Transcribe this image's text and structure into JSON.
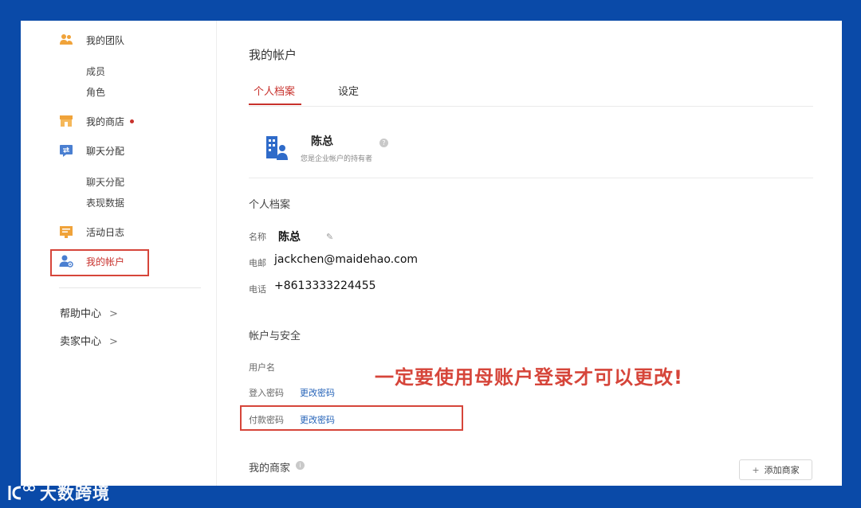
{
  "sidebar": {
    "team": {
      "label": "我的团队",
      "icon": "team-icon",
      "subitems": [
        "成员",
        "角色"
      ]
    },
    "store": {
      "label": "我的商店",
      "icon": "store-icon",
      "has_dot": true
    },
    "chat": {
      "label": "聊天分配",
      "icon": "chat-assign-icon",
      "subitems": [
        "聊天分配",
        "表现数据"
      ]
    },
    "log": {
      "label": "活动日志",
      "icon": "activity-log-icon"
    },
    "account": {
      "label": "我的帐户",
      "icon": "account-settings-icon",
      "active": true
    },
    "footer": [
      {
        "label": "帮助中心",
        "chevron": ">"
      },
      {
        "label": "卖家中心",
        "chevron": ">"
      }
    ]
  },
  "main": {
    "title": "我的帐户",
    "tabs": [
      {
        "label": "个人档案",
        "active": true
      },
      {
        "label": "设定",
        "active": false
      }
    ],
    "owner": {
      "name": "陈总",
      "description": "您是企业帐户的持有者",
      "help_glyph": "?"
    },
    "profile": {
      "section_title": "个人档案",
      "fields": [
        {
          "label": "名称",
          "value": "陈总"
        },
        {
          "label": "电邮",
          "value": "jackchen@maidehao.com"
        },
        {
          "label": "电话",
          "value": "+8613333224455"
        }
      ],
      "edit_glyph": "✎"
    },
    "security": {
      "section_title": "帐户与安全",
      "username_label": "用户名",
      "login_password_label": "登入密码",
      "login_password_link": "更改密码",
      "payment_password_label": "付款密码",
      "payment_password_link": "更改密码"
    },
    "annotation": "一定要使用母账户登录才可以更改!",
    "merchants": {
      "section_title": "我的商家",
      "help_glyph": "i",
      "add_button": "添加商家",
      "add_glyph": "+"
    }
  },
  "watermark": {
    "text": "大数跨境"
  },
  "colors": {
    "accent_red": "#c8312c",
    "link_blue": "#2563b8",
    "frame_blue": "#0a4aa8",
    "annotation_red": "#d6453a",
    "icon_orange": "#f0a33a",
    "icon_blue": "#4a7fd1"
  }
}
